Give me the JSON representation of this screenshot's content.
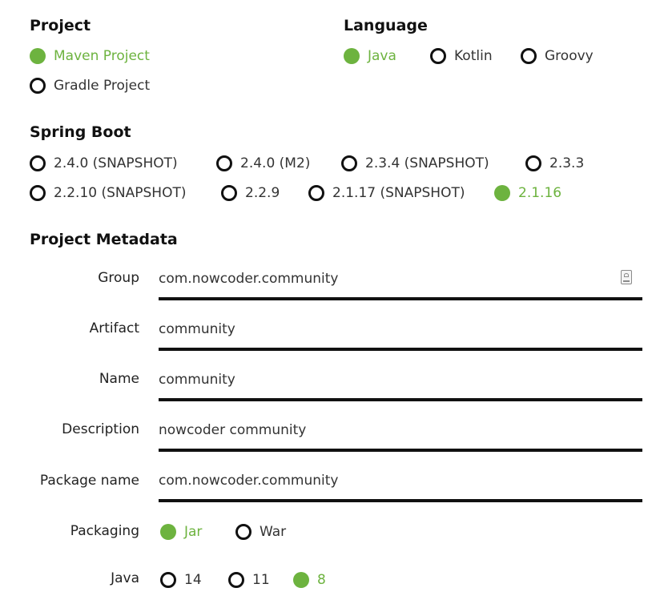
{
  "colors": {
    "accent": "#6db33f",
    "ink": "#111111"
  },
  "project": {
    "title": "Project",
    "options": [
      {
        "label": "Maven Project",
        "checked": true
      },
      {
        "label": "Gradle Project",
        "checked": false
      }
    ]
  },
  "language": {
    "title": "Language",
    "options": [
      {
        "label": "Java",
        "checked": true
      },
      {
        "label": "Kotlin",
        "checked": false
      },
      {
        "label": "Groovy",
        "checked": false
      }
    ]
  },
  "spring_boot": {
    "title": "Spring Boot",
    "options": [
      {
        "label": "2.4.0 (SNAPSHOT)",
        "checked": false
      },
      {
        "label": "2.4.0 (M2)",
        "checked": false
      },
      {
        "label": "2.3.4 (SNAPSHOT)",
        "checked": false
      },
      {
        "label": "2.3.3",
        "checked": false
      },
      {
        "label": "2.2.10 (SNAPSHOT)",
        "checked": false
      },
      {
        "label": "2.2.9",
        "checked": false
      },
      {
        "label": "2.1.17 (SNAPSHOT)",
        "checked": false
      },
      {
        "label": "2.1.16",
        "checked": true
      }
    ]
  },
  "metadata": {
    "title": "Project Metadata",
    "fields": {
      "group": {
        "label": "Group",
        "value": "com.nowcoder.community",
        "icon": "clipboard-icon"
      },
      "artifact": {
        "label": "Artifact",
        "value": "community"
      },
      "name": {
        "label": "Name",
        "value": "community"
      },
      "description": {
        "label": "Description",
        "value": "nowcoder community"
      },
      "package_name": {
        "label": "Package name",
        "value": "com.nowcoder.community"
      }
    },
    "packaging": {
      "label": "Packaging",
      "options": [
        {
          "label": "Jar",
          "checked": true
        },
        {
          "label": "War",
          "checked": false
        }
      ]
    },
    "java": {
      "label": "Java",
      "options": [
        {
          "label": "14",
          "checked": false
        },
        {
          "label": "11",
          "checked": false
        },
        {
          "label": "8",
          "checked": true
        }
      ]
    }
  }
}
